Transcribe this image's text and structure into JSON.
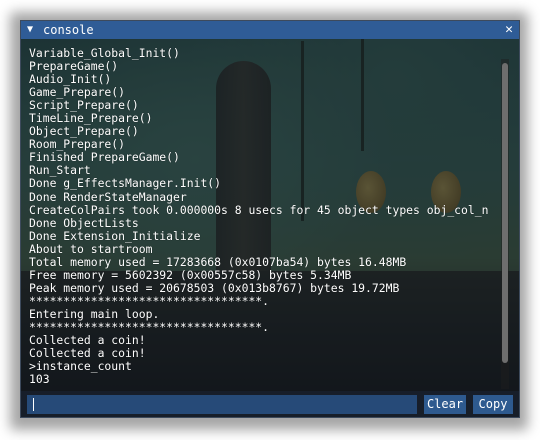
{
  "window": {
    "title": "console",
    "collapse_icon": "triangle-down-icon",
    "close_icon": "close-icon",
    "close_glyph": "✕",
    "collapse_glyph": "▼"
  },
  "log": {
    "lines": [
      "Variable_Global_Init()",
      "PrepareGame()",
      "Audio_Init()",
      "Game_Prepare()",
      "Script_Prepare()",
      "TimeLine_Prepare()",
      "Object_Prepare()",
      "Room_Prepare()",
      "Finished PrepareGame()",
      "Run_Start",
      "Done g_EffectsManager.Init()",
      "Done RenderStateManager",
      "CreateColPairs took 0.000000s 8 usecs for 45 object types obj_col_n",
      "Done ObjectLists",
      "Done Extension_Initialize",
      "About to startroom",
      "Total memory used = 17283668 (0x0107ba54) bytes 16.48MB",
      "Free memory = 5602392 (0x00557c58) bytes 5.34MB",
      "Peak memory used = 20678503 (0x013b8767) bytes 19.72MB",
      "**********************************.",
      "Entering main loop.",
      "**********************************.",
      "Collected a coin!",
      "Collected a coin!",
      ">instance_count",
      "103"
    ]
  },
  "input": {
    "value": ""
  },
  "buttons": {
    "clear_label": "Clear",
    "copy_label": "Copy"
  },
  "colors": {
    "title_bar": "#2f5c96",
    "input_bg": "#264a78",
    "button_bg": "#2e5a8f",
    "text": "#ffffff"
  }
}
